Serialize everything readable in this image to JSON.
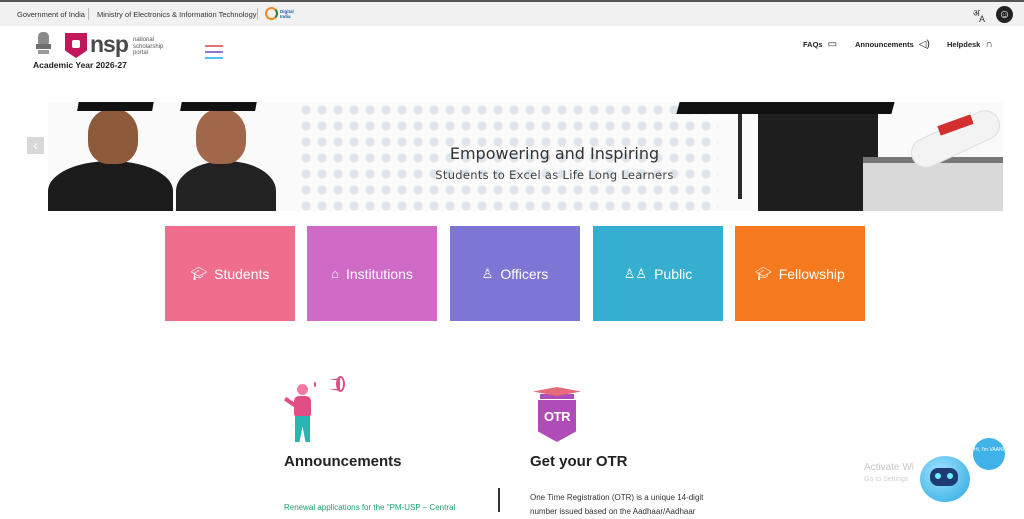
{
  "gov_bar": {
    "government": "Government of India",
    "ministry": "Ministry of Electronics & Information Technology",
    "digital_india": "Digital India"
  },
  "header": {
    "logo_text": "nsp",
    "logo_sub": "national scholarship portal",
    "academic_year": "Academic Year 2026-27",
    "nav": [
      {
        "label": "FAQs",
        "icon": "chat-icon"
      },
      {
        "label": "Announcements",
        "icon": "megaphone-icon"
      },
      {
        "label": "Helpdesk",
        "icon": "headset-icon"
      }
    ]
  },
  "banner": {
    "title": "Empowering and Inspiring",
    "subtitle": "Students to Excel as Life Long Learners"
  },
  "tiles": [
    {
      "label": "Students",
      "icon": "graduation-cap-icon",
      "color": "#f06e8d"
    },
    {
      "label": "Institutions",
      "icon": "building-icon",
      "color": "#d06ac7"
    },
    {
      "label": "Officers",
      "icon": "user-icon",
      "color": "#7e76d5"
    },
    {
      "label": "Public",
      "icon": "users-icon",
      "color": "#36aecf"
    },
    {
      "label": "Fellowship",
      "icon": "graduation-cap-icon",
      "color": "#f5791e"
    }
  ],
  "announcements": {
    "title": "Announcements",
    "first_item": "Renewal applications for the \"PM-USP – Central"
  },
  "otr": {
    "icon_text": "OTR",
    "title": "Get your OTR",
    "text": "One Time Registration (OTR) is a unique 14-digit number issued based on the Aadhaar/Aadhaar"
  },
  "overlay": {
    "activate": "Activate Wi",
    "activate_sub": "Go to Settings",
    "bot_bubble": "Hi, I'm VAANI"
  }
}
